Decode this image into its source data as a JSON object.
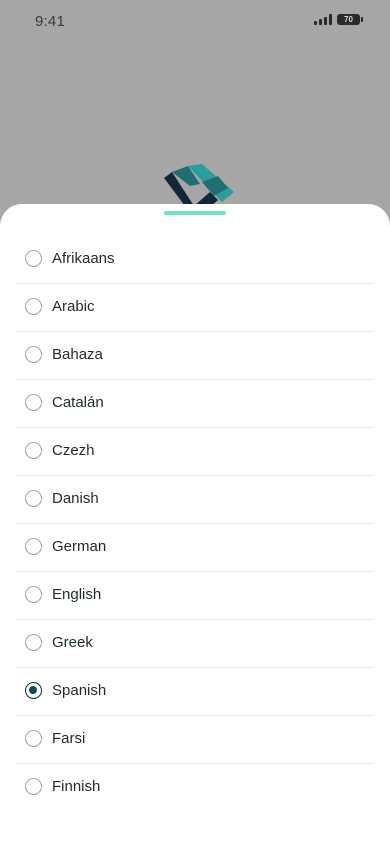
{
  "status_bar": {
    "time": "9:41",
    "battery": "70"
  },
  "logo": {
    "icon": "app-logo-icon",
    "colors": [
      "#14263a",
      "#1f6e74",
      "#2b9e9b"
    ]
  },
  "sheet": {
    "handle_color": "#70e0d0",
    "selected_index": 9,
    "languages": [
      {
        "label": "Afrikaans",
        "selected": false
      },
      {
        "label": "Arabic",
        "selected": false
      },
      {
        "label": "Bahaza",
        "selected": false
      },
      {
        "label": "Catalán",
        "selected": false
      },
      {
        "label": "Czezh",
        "selected": false
      },
      {
        "label": "Danish",
        "selected": false
      },
      {
        "label": "German",
        "selected": false
      },
      {
        "label": "English",
        "selected": false
      },
      {
        "label": "Greek",
        "selected": false
      },
      {
        "label": "Spanish",
        "selected": true
      },
      {
        "label": "Farsi",
        "selected": false
      },
      {
        "label": "Finnish",
        "selected": false
      }
    ]
  }
}
